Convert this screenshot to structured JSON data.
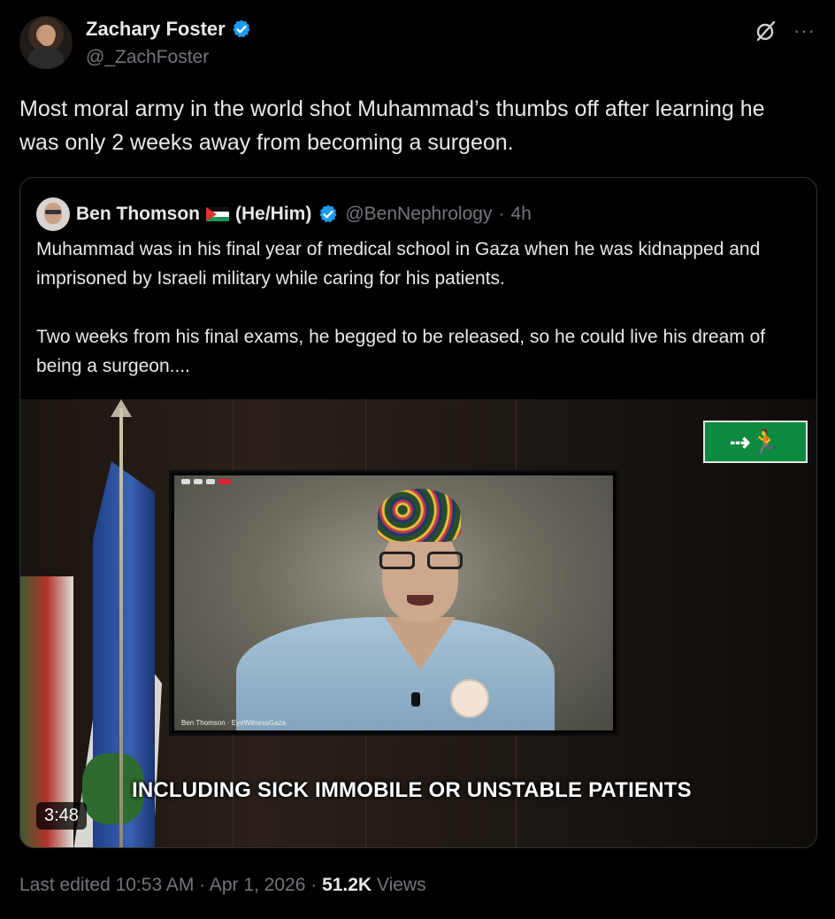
{
  "author": {
    "display_name": "Zachary Foster",
    "handle": "@_ZachFoster",
    "verified": true
  },
  "icons": {
    "grok": "grok-icon",
    "more": "more-options-icon",
    "verified": "verified-badge-icon"
  },
  "tweet": {
    "text": "Most moral army in the world shot Muhammad’s thumbs off after learning he was only 2 weeks away from becoming a surgeon."
  },
  "quoted": {
    "display_name": "Ben Thomson",
    "flag": "palestine-flag-icon",
    "pronouns": "(He/Him)",
    "handle": "@BenNephrology",
    "separator": "·",
    "time": "4h",
    "text": "Muhammad was in his final year of medical school in Gaza when he was kidnapped and imprisoned by Israeli military while caring for his patients.\n\nTwo weeks from his final exams, he begged to be released, so he could live his dream of being a surgeon....",
    "video": {
      "duration": "3:48",
      "caption": "INCLUDING SICK IMMOBILE OR UNSTABLE PATIENTS",
      "screen_label": "Ben Thomson · EyeWitnessGaza"
    }
  },
  "meta": {
    "edited": "Last edited 10:53 AM · Apr 1, 2026 ·",
    "views_count": "51.2K",
    "views_label": "Views"
  },
  "colors": {
    "background": "#000000",
    "text": "#e7e9ea",
    "muted": "#71767b",
    "verified": "#1d9bf0"
  }
}
